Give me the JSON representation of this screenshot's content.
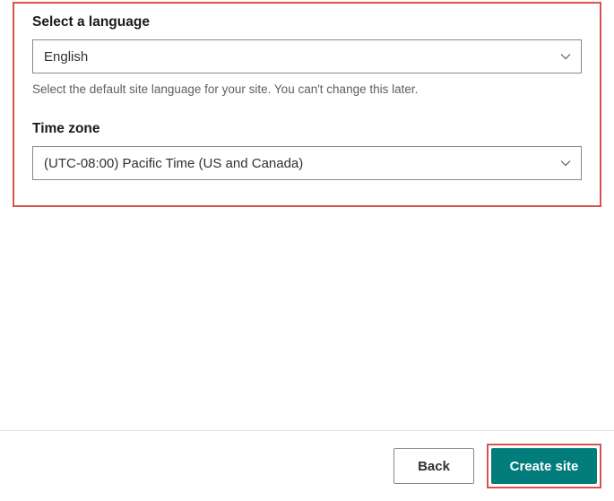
{
  "form": {
    "language": {
      "label": "Select a language",
      "value": "English",
      "helper": "Select the default site language for your site. You can't change this later."
    },
    "timezone": {
      "label": "Time zone",
      "value": "(UTC-08:00) Pacific Time (US and Canada)"
    }
  },
  "footer": {
    "back": "Back",
    "create": "Create site"
  }
}
